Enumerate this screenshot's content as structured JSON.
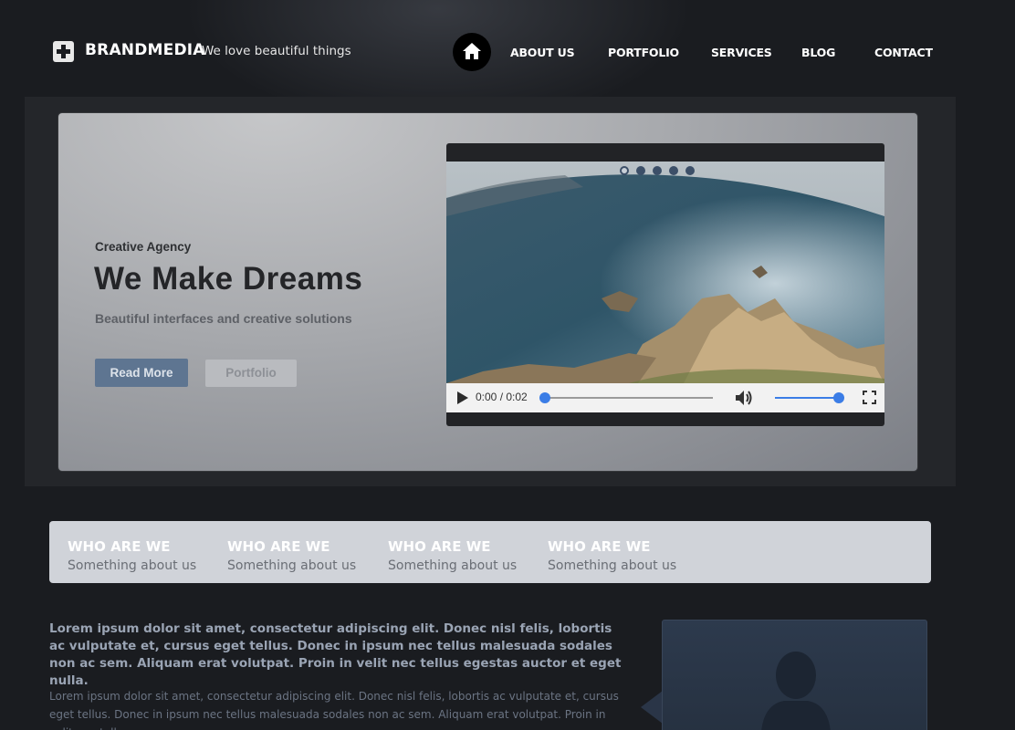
{
  "header": {
    "brand": "BRANDMEDIA",
    "tagline": "We love beautiful things",
    "nav": [
      "ABOUT US",
      "PORTFOLIO",
      "SERVICES",
      "BLOG",
      "CONTACT"
    ]
  },
  "hero": {
    "kicker": "Creative Agency",
    "headline": "We Make Dreams",
    "subheadline": "Beautiful interfaces and creative solutions",
    "read_more": "Read More",
    "portfolio": "Portfolio",
    "slide_count": 5,
    "active_slide": 1
  },
  "video": {
    "time": "0:00 / 0:02",
    "progress": 0.0,
    "volume": 1.0
  },
  "tabs": [
    {
      "title": "WHO ARE WE",
      "subtitle": "Something about us"
    },
    {
      "title": "WHO ARE WE",
      "subtitle": "Something about us"
    },
    {
      "title": "WHO ARE WE",
      "subtitle": "Something about us"
    },
    {
      "title": "WHO ARE WE",
      "subtitle": "Something about us"
    }
  ],
  "content": {
    "lead": "Lorem ipsum dolor sit amet, consectetur adipiscing elit. Donec nisl felis, lobortis ac vulputate et, cursus eget tellus. Donec in ipsum nec tellus malesuada sodales non ac sem. Aliquam erat volutpat. Proin in velit nec tellus egestas auctor et eget nulla.",
    "body": "Lorem ipsum dolor sit amet, consectetur adipiscing elit. Donec nisl felis, lobortis ac vulputate et, cursus eget tellus. Donec in ipsum nec tellus malesuada sodales non ac sem. Aliquam erat volutpat. Proin in velit nec tellus"
  },
  "colors": {
    "background": "#1a1c20",
    "accent_blue": "#3b7de6",
    "button_blue": "#5e7591"
  }
}
